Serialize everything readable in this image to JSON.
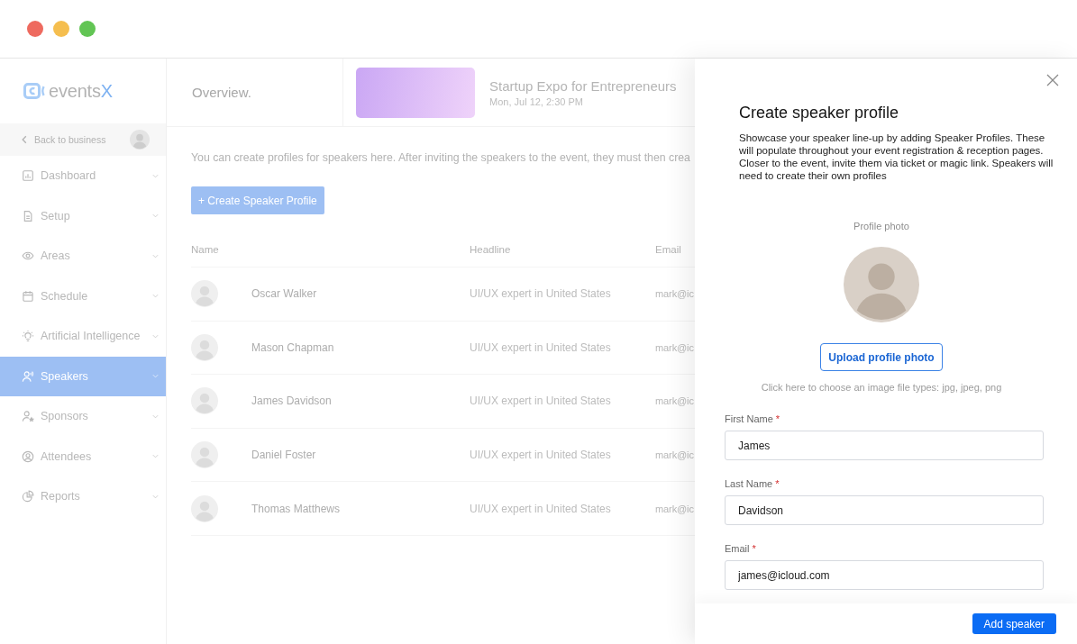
{
  "sidebar": {
    "logo": {
      "name": "events",
      "accent": "X"
    },
    "back_link": "Back to business",
    "items": [
      {
        "label": "Dashboard",
        "selected": false
      },
      {
        "label": "Setup",
        "selected": false
      },
      {
        "label": "Areas",
        "selected": false
      },
      {
        "label": "Schedule",
        "selected": false
      },
      {
        "label": "Artificial Intelligence",
        "selected": false
      },
      {
        "label": "Speakers",
        "selected": true
      },
      {
        "label": "Sponsors",
        "selected": false
      },
      {
        "label": "Attendees",
        "selected": false
      },
      {
        "label": "Reports",
        "selected": false
      }
    ]
  },
  "header": {
    "title": "Overview.",
    "event": {
      "title": "Startup Expo for Entrepreneurs",
      "date": "Mon, Jul 12, 2:30 PM"
    }
  },
  "content": {
    "description": "You can create profiles for speakers here. After inviting the speakers to the event, they must then crea",
    "create_button": "+ Create Speaker Profile",
    "table": {
      "columns": [
        "Name",
        "Headline",
        "Email"
      ],
      "rows": [
        {
          "name": "Oscar Walker",
          "headline": "UI/UX expert in United States",
          "email": "mark@ic"
        },
        {
          "name": "Mason Chapman",
          "headline": "UI/UX expert in United States",
          "email": "mark@ic"
        },
        {
          "name": "James Davidson",
          "headline": "UI/UX expert in United States",
          "email": "mark@ic"
        },
        {
          "name": "Daniel Foster",
          "headline": "UI/UX expert in United States",
          "email": "mark@ic"
        },
        {
          "name": "Thomas Matthews",
          "headline": "UI/UX expert in United States",
          "email": "mark@ic"
        }
      ]
    }
  },
  "drawer": {
    "title": "Create speaker profile",
    "description": "Showcase your speaker line-up by adding Speaker Profiles. These will populate throughout your event registration & reception pages. Closer to the event, invite them via ticket or magic link. Speakers will need to create their own profiles",
    "photo_label": "Profile photo",
    "upload_button": "Upload profile photo",
    "upload_hint": "Click here to choose an image file types: jpg, jpeg, png",
    "fields": [
      {
        "label": "First Name",
        "required_mark": "*",
        "value": "James"
      },
      {
        "label": "Last Name",
        "required_mark": "*",
        "value": "Davidson"
      },
      {
        "label": "Email",
        "required_mark": "*",
        "value": "james@icloud.com"
      }
    ],
    "submit_button": "Add speaker"
  }
}
